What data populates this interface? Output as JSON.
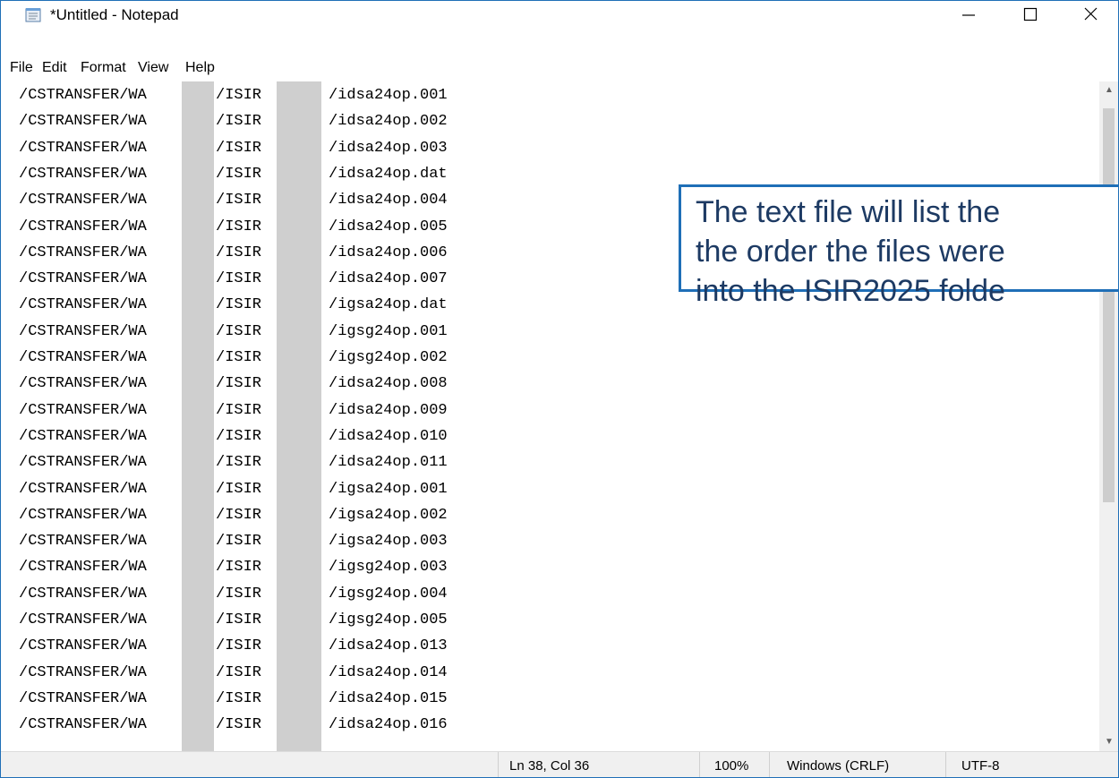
{
  "window": {
    "title": "*Untitled - Notepad"
  },
  "menu": [
    "File",
    "Edit",
    "Format",
    "View",
    "Help"
  ],
  "lines": [
    {
      "a": "/CSTRANSFER/WA",
      "b": "/ISIR",
      "c": "/idsa24op.001"
    },
    {
      "a": "/CSTRANSFER/WA",
      "b": "/ISIR",
      "c": "/idsa24op.002"
    },
    {
      "a": "/CSTRANSFER/WA",
      "b": "/ISIR",
      "c": "/idsa24op.003"
    },
    {
      "a": "/CSTRANSFER/WA",
      "b": "/ISIR",
      "c": "/idsa24op.dat"
    },
    {
      "a": "/CSTRANSFER/WA",
      "b": "/ISIR",
      "c": "/idsa24op.004"
    },
    {
      "a": "/CSTRANSFER/WA",
      "b": "/ISIR",
      "c": "/idsa24op.005"
    },
    {
      "a": "/CSTRANSFER/WA",
      "b": "/ISIR",
      "c": "/idsa24op.006"
    },
    {
      "a": "/CSTRANSFER/WA",
      "b": "/ISIR",
      "c": "/idsa24op.007"
    },
    {
      "a": "/CSTRANSFER/WA",
      "b": "/ISIR",
      "c": "/igsa24op.dat"
    },
    {
      "a": "/CSTRANSFER/WA",
      "b": "/ISIR",
      "c": "/igsg24op.001"
    },
    {
      "a": "/CSTRANSFER/WA",
      "b": "/ISIR",
      "c": "/igsg24op.002"
    },
    {
      "a": "/CSTRANSFER/WA",
      "b": "/ISIR",
      "c": "/idsa24op.008"
    },
    {
      "a": "/CSTRANSFER/WA",
      "b": "/ISIR",
      "c": "/idsa24op.009"
    },
    {
      "a": "/CSTRANSFER/WA",
      "b": "/ISIR",
      "c": "/idsa24op.010"
    },
    {
      "a": "/CSTRANSFER/WA",
      "b": "/ISIR",
      "c": "/idsa24op.011"
    },
    {
      "a": "/CSTRANSFER/WA",
      "b": "/ISIR",
      "c": "/igsa24op.001"
    },
    {
      "a": "/CSTRANSFER/WA",
      "b": "/ISIR",
      "c": "/igsa24op.002"
    },
    {
      "a": "/CSTRANSFER/WA",
      "b": "/ISIR",
      "c": "/igsa24op.003"
    },
    {
      "a": "/CSTRANSFER/WA",
      "b": "/ISIR",
      "c": "/igsg24op.003"
    },
    {
      "a": "/CSTRANSFER/WA",
      "b": "/ISIR",
      "c": "/igsg24op.004"
    },
    {
      "a": "/CSTRANSFER/WA",
      "b": "/ISIR",
      "c": "/igsg24op.005"
    },
    {
      "a": "/CSTRANSFER/WA",
      "b": "/ISIR",
      "c": "/idsa24op.013"
    },
    {
      "a": "/CSTRANSFER/WA",
      "b": "/ISIR",
      "c": "/idsa24op.014"
    },
    {
      "a": "/CSTRANSFER/WA",
      "b": "/ISIR",
      "c": "/idsa24op.015"
    },
    {
      "a": "/CSTRANSFER/WA",
      "b": "/ISIR",
      "c": "/idsa24op.016"
    }
  ],
  "status": {
    "position": "Ln 38, Col 36",
    "zoom": "100%",
    "line_ending": "Windows (CRLF)",
    "encoding": "UTF-8"
  },
  "callout": {
    "lines": [
      "The text file will list the",
      "the order the files were",
      "into the ISIR2025 folde"
    ]
  },
  "icons": {
    "app": "notepad-icon",
    "minimize": "minimize-icon",
    "maximize": "maximize-icon",
    "close": "close-icon",
    "scroll_up": "chevron-up-icon",
    "scroll_down": "chevron-down-icon"
  },
  "colors": {
    "accent": "#1f6fb7",
    "callout_text": "#1d3a63"
  }
}
